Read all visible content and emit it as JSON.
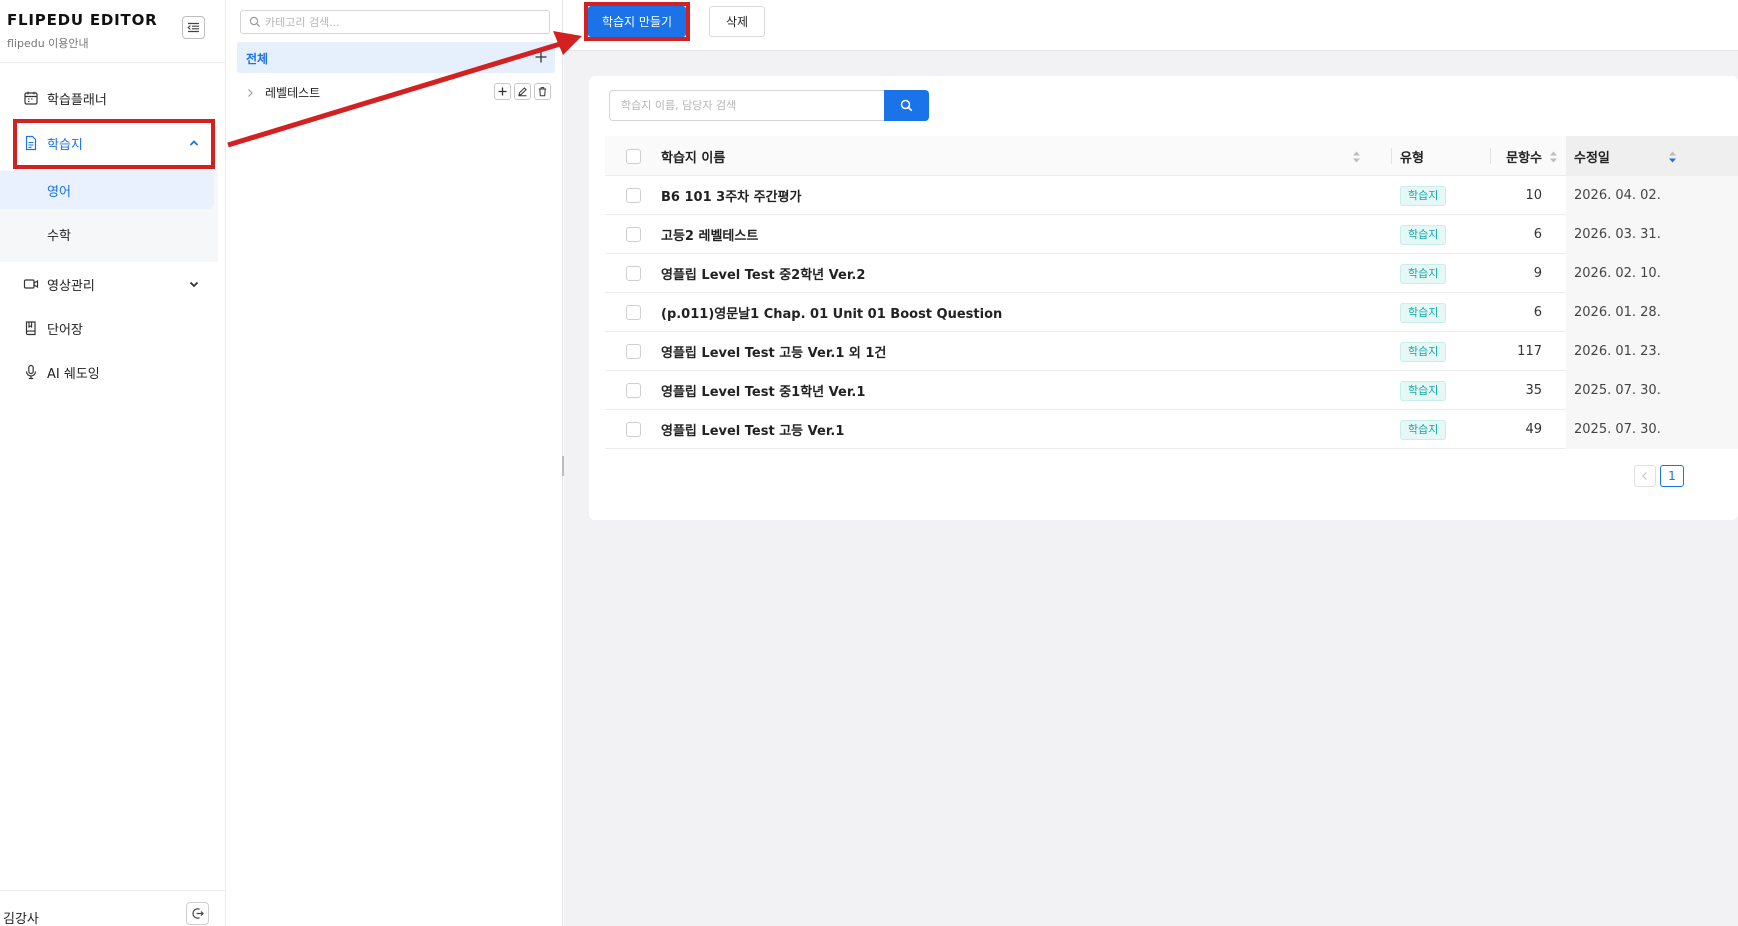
{
  "brand": {
    "title": "FLIPEDU EDITOR",
    "subtitle": "flipedu 이용안내"
  },
  "sidebar": {
    "items": [
      {
        "label": "학습플래너",
        "icon": "calendar-icon"
      },
      {
        "label": "학습지",
        "icon": "document-icon",
        "expanded": true
      },
      {
        "label": "영상관리",
        "icon": "video-icon"
      },
      {
        "label": "단어장",
        "icon": "book-icon"
      },
      {
        "label": "AI 쉐도잉",
        "icon": "microphone-icon"
      }
    ],
    "sub_items": [
      {
        "label": "영어",
        "active": true
      },
      {
        "label": "수학"
      }
    ],
    "user": "김강사"
  },
  "category": {
    "search_placeholder": "카테고리 검색...",
    "all_label": "전체",
    "items": [
      {
        "label": "레벨테스트"
      }
    ]
  },
  "toolbar": {
    "create_label": "학습지 만들기",
    "delete_label": "삭제"
  },
  "search": {
    "placeholder": "학습지 이름, 담당자 검색"
  },
  "table": {
    "headers": {
      "name": "학습지 이름",
      "type": "유형",
      "count": "문항수",
      "date": "수정일"
    },
    "rows": [
      {
        "name": "B6 101 3주차 주간평가",
        "type": "학습지",
        "count": "10",
        "date": "2026. 04. 02."
      },
      {
        "name": "고등2 레벨테스트",
        "type": "학습지",
        "count": "6",
        "date": "2026. 03. 31."
      },
      {
        "name": "영플립 Level Test 중2학년 Ver.2",
        "type": "학습지",
        "count": "9",
        "date": "2026. 02. 10."
      },
      {
        "name": "(p.011)영문날1 Chap. 01 Unit 01 Boost Question",
        "type": "학습지",
        "count": "6",
        "date": "2026. 01. 28."
      },
      {
        "name": "영플립 Level Test 고등 Ver.1 외 1건",
        "type": "학습지",
        "count": "117",
        "date": "2026. 01. 23."
      },
      {
        "name": "영플립 Level Test 중1학년 Ver.1",
        "type": "학습지",
        "count": "35",
        "date": "2025. 07. 30."
      },
      {
        "name": "영플립 Level Test 고등 Ver.1",
        "type": "학습지",
        "count": "49",
        "date": "2025. 07. 30."
      }
    ]
  },
  "pagination": {
    "current": "1"
  },
  "colors": {
    "accent": "#1a73e8",
    "annotation": "#d32020",
    "tag_text": "#13a8a8",
    "tag_bg": "#e6f8f6"
  }
}
